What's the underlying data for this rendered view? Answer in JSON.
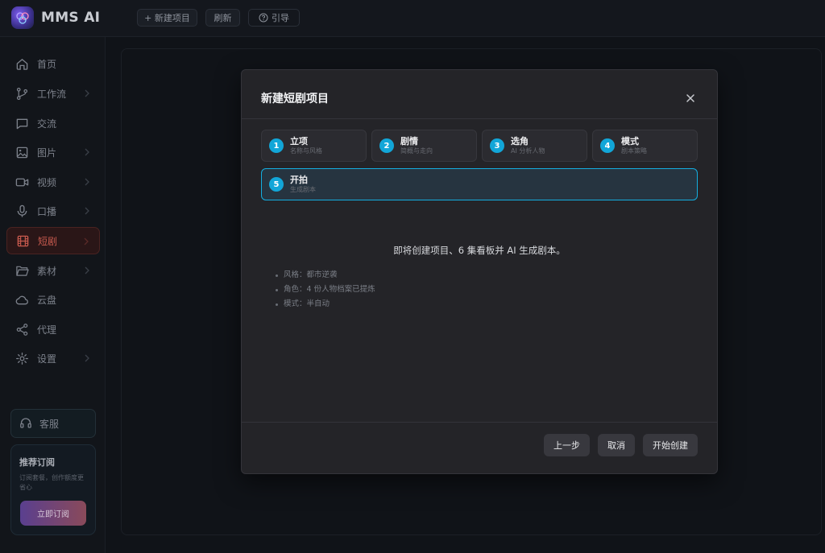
{
  "app": {
    "brand": "MMS AI"
  },
  "topbar": {
    "new_project": "+ 新建项目",
    "refresh": "刷新",
    "guide": "引导"
  },
  "sidebar": {
    "items": [
      {
        "label": "首页"
      },
      {
        "label": "工作流"
      },
      {
        "label": "交流"
      },
      {
        "label": "图片"
      },
      {
        "label": "视频"
      },
      {
        "label": "口播"
      },
      {
        "label": "短剧"
      },
      {
        "label": "素材"
      },
      {
        "label": "云盘"
      },
      {
        "label": "代理"
      },
      {
        "label": "设置"
      }
    ],
    "support": "客服",
    "subscribe": {
      "title": "推荐订阅",
      "desc": "订阅套餐，创作额度更省心",
      "button": "立即订阅"
    }
  },
  "modal": {
    "title": "新建短剧项目",
    "steps": [
      {
        "num": "1",
        "label": "立项",
        "sub": "名称与风格"
      },
      {
        "num": "2",
        "label": "剧情",
        "sub": "简概与走向"
      },
      {
        "num": "3",
        "label": "选角",
        "sub": "AI 分析人物"
      },
      {
        "num": "4",
        "label": "模式",
        "sub": "剧本策略"
      },
      {
        "num": "5",
        "label": "开拍",
        "sub": "生成剧本"
      }
    ],
    "summary": "即将创建项目、6 集看板并 AI 生成剧本。",
    "bullets": [
      "风格：都市逆袭",
      "角色：4 份人物档案已提炼",
      "模式：半自动"
    ],
    "buttons": {
      "prev": "上一步",
      "cancel": "取消",
      "create": "开始创建"
    }
  },
  "colors": {
    "accent": "#12a6d8",
    "active_nav": "#c85a4e"
  }
}
